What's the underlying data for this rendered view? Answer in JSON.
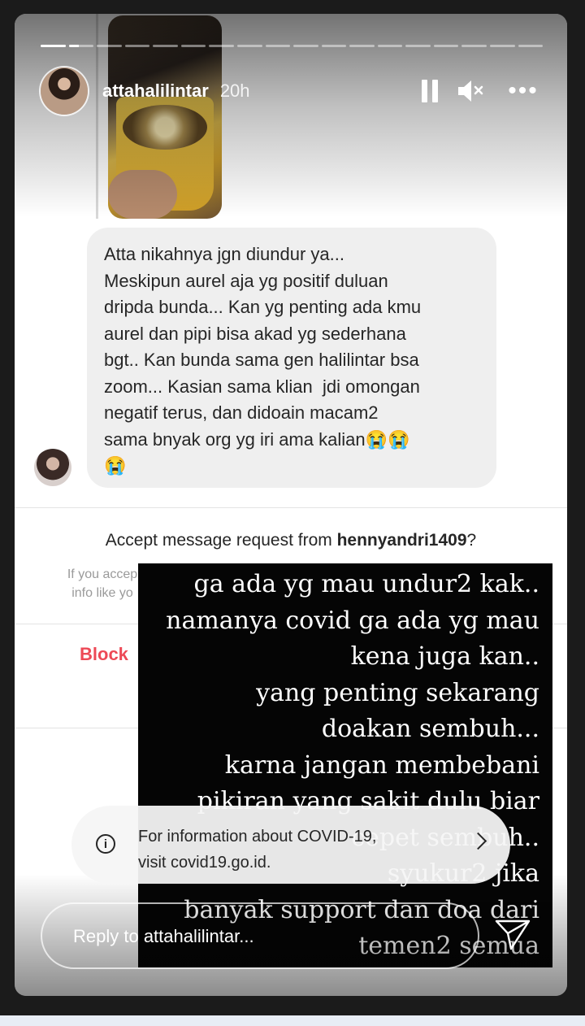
{
  "story": {
    "progress": [
      1,
      0.4,
      0,
      0,
      0,
      0,
      0,
      0,
      0,
      0,
      0,
      0,
      0,
      0,
      0,
      0,
      0,
      0
    ],
    "username": "attahalilintar",
    "time_ago": "20h",
    "icons": {
      "pause": "pause-icon",
      "mute": "mute-icon",
      "more": "more-icon"
    }
  },
  "message": {
    "text": "Atta nikahnya jgn diundur ya...\nMeskipun aurel aja yg positif duluan\ndripda bunda... Kan yg penting ada kmu\naurel dan pipi bisa akad yg sederhana\nbgt.. Kan bunda sama gen halilintar bsa\nzoom... Kasian sama klian  jdi omongan\nnegatif terus, dan didoain macam2\nsama bnyak org yg iri ama kalian😭😭\n😭"
  },
  "request": {
    "prefix": "Accept message request from ",
    "username": "hennyandri1409",
    "suffix": "?",
    "hint": "If you accep\ninfo like yo",
    "block_label": "Block"
  },
  "overlay": {
    "text": "ga ada yg mau undur2 kak..\nnamanya covid ga ada yg mau\nkena juga kan..\nyang penting sekarang\ndoakan sembuh...\nkarna jangan membebani\npikiran yang sakit dulu biar\ncepet sembuh..\nsyukur2 jika\nbanyak support dan doa dari\ntemen2 semua"
  },
  "covid_banner": {
    "text": "For information about COVID-19,\nvisit covid19.go.id.",
    "icon": "info-icon"
  },
  "reply": {
    "placeholder": "Reply to attahalilintar...",
    "send_icon": "send-icon"
  }
}
